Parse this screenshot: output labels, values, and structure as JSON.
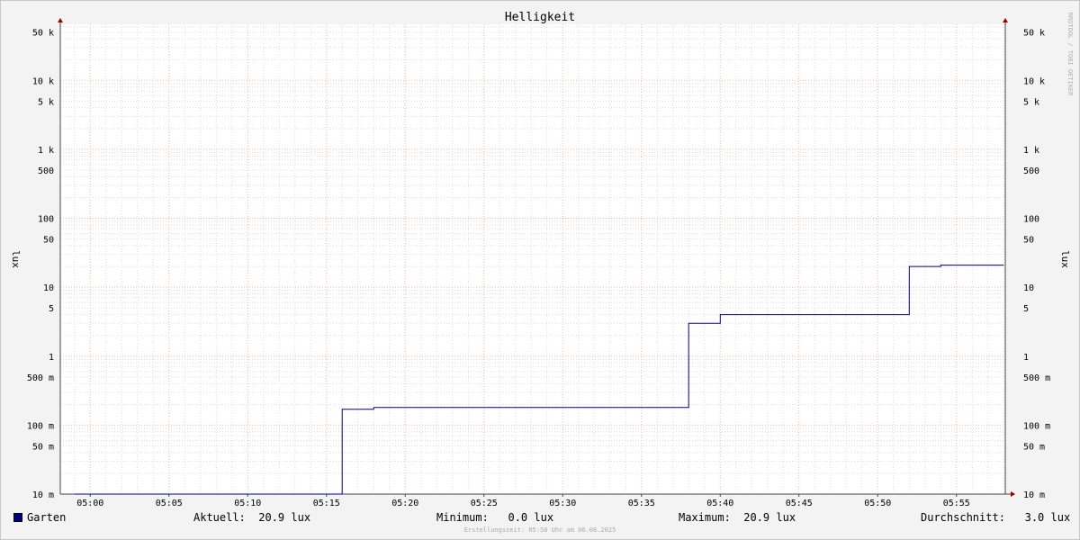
{
  "chart_data": {
    "type": "line",
    "title": "Helligkeit",
    "ylabel_left": "lux",
    "ylabel_right": "lux",
    "yscale": "log",
    "ylim": [
      10,
      65000
    ],
    "x_range_min": [
      -1,
      58
    ],
    "x_ticks": [
      "05:00",
      "05:05",
      "05:10",
      "05:15",
      "05:20",
      "05:25",
      "05:30",
      "05:35",
      "05:40",
      "05:45",
      "05:50",
      "05:55"
    ],
    "y_ticks": [
      {
        "value": 10,
        "label": "10 m"
      },
      {
        "value": 50,
        "label": "50 m"
      },
      {
        "value": 100,
        "label": "100 m"
      },
      {
        "value": 500,
        "label": "500 m"
      },
      {
        "value": 1000,
        "label": "1"
      },
      {
        "value": 5000,
        "label": "5"
      },
      {
        "value": 10000,
        "label": "10"
      },
      {
        "value": 50000,
        "label": "50"
      },
      {
        "value": 100000,
        "label": "100"
      },
      {
        "value": 500000,
        "label": "500"
      },
      {
        "value": 1000000,
        "label": "1 k"
      },
      {
        "value": 5000000,
        "label": "5 k"
      },
      {
        "value": 10000000,
        "label": "10 k"
      },
      {
        "value": 50000000,
        "label": "50 k"
      }
    ],
    "series": [
      {
        "name": "Garten",
        "color": "#000080",
        "points": [
          [
            "04:59",
            0.01
          ],
          [
            "05:16",
            0.01
          ],
          [
            "05:16",
            0.17
          ],
          [
            "05:18",
            0.17
          ],
          [
            "05:18",
            0.18
          ],
          [
            "05:38",
            0.18
          ],
          [
            "05:38",
            3.0
          ],
          [
            "05:40",
            3.0
          ],
          [
            "05:40",
            4.0
          ],
          [
            "05:52",
            4.0
          ],
          [
            "05:52",
            20.0
          ],
          [
            "05:54",
            20.0
          ],
          [
            "05:54",
            20.9
          ],
          [
            "05:58",
            20.9
          ]
        ]
      }
    ],
    "grid": true,
    "legend": "bottom"
  },
  "legend": {
    "series_label": "Garten",
    "series_color": "#000080",
    "current": "Aktuell:  20.9 lux",
    "minimum": "Minimum:   0.0 lux",
    "maximum": "Maximum:  20.9 lux",
    "average": "Durchschnitt:   3.0 lux"
  },
  "watermark": "RRDTOOL / TOBI OETIKER",
  "footer": "Erstellungszeit: 05:58 Uhr am 06.08.2025"
}
